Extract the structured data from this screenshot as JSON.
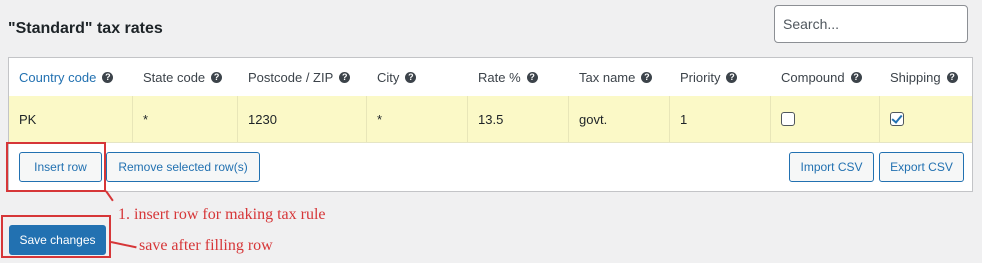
{
  "page": {
    "title": "\"Standard\" tax rates"
  },
  "search": {
    "placeholder": "Search..."
  },
  "table": {
    "columns": [
      {
        "label": "Country code",
        "help": "?"
      },
      {
        "label": "State code",
        "help": "?"
      },
      {
        "label": "Postcode / ZIP",
        "help": "?"
      },
      {
        "label": "City",
        "help": "?"
      },
      {
        "label": "Rate %",
        "help": "?"
      },
      {
        "label": "Tax name",
        "help": "?"
      },
      {
        "label": "Priority",
        "help": "?"
      },
      {
        "label": "Compound",
        "help": "?"
      },
      {
        "label": "Shipping",
        "help": "?"
      }
    ],
    "rows": [
      {
        "country": "PK",
        "state": "*",
        "postcode": "1230",
        "city": "*",
        "rate": "13.5",
        "tax_name": "govt.",
        "priority": "1",
        "compound": false,
        "shipping": true
      }
    ]
  },
  "actions": {
    "insert_row": "Insert row",
    "remove_rows": "Remove selected row(s)",
    "import_csv": "Import CSV",
    "export_csv": "Export CSV",
    "save_changes": "Save changes"
  },
  "annotations": {
    "insert_note": "1. insert row for making tax rule",
    "save_note": "save after filling row",
    "color": "#d63638"
  },
  "colors": {
    "accent": "#2271b1",
    "row_highlight": "#fbf9c7"
  }
}
